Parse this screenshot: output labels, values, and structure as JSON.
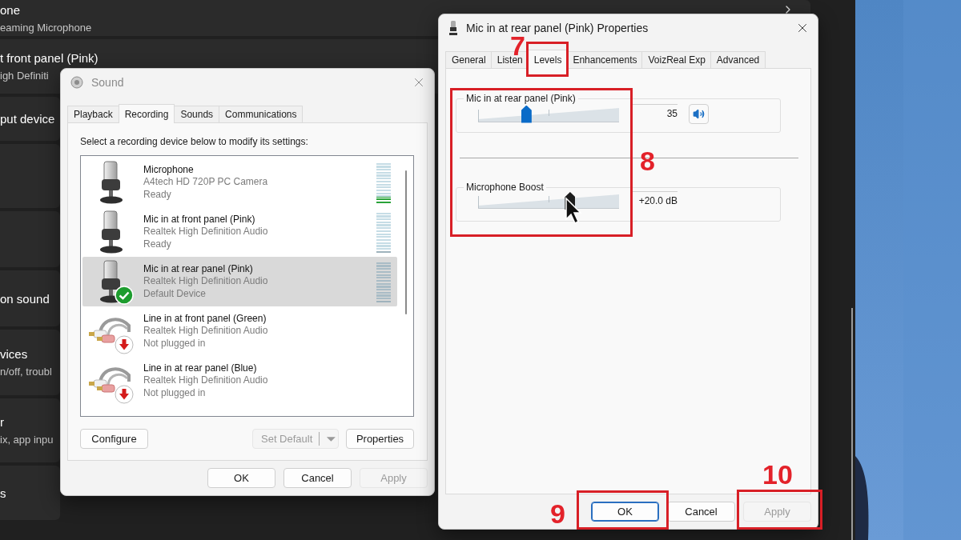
{
  "settings_app": {
    "rows": [
      {
        "title": "one",
        "subtitle": "eaming Microphone"
      },
      {
        "title": "t front panel (Pink)",
        "subtitle": "igh Definiti"
      },
      {
        "title": "put device"
      },
      {
        "title": "on sound"
      },
      {
        "title": "vices",
        "subtitle": "n/off, troubl"
      },
      {
        "title": "r",
        "subtitle": "ix, app inpu"
      },
      {
        "title": "s"
      }
    ]
  },
  "sound_window": {
    "title": "Sound",
    "active": false,
    "tabs": [
      {
        "label": "Playback",
        "selected": false
      },
      {
        "label": "Recording",
        "selected": true
      },
      {
        "label": "Sounds",
        "selected": false
      },
      {
        "label": "Communications",
        "selected": false
      }
    ],
    "instruction": "Select a recording device below to modify its settings:",
    "devices": [
      {
        "name": "Microphone",
        "driver": "A4tech HD 720P PC Camera",
        "status": "Ready",
        "kind": "mic",
        "default_device": false,
        "unplugged": false,
        "level": 0.15,
        "selected": false
      },
      {
        "name": "Mic in at front panel (Pink)",
        "driver": "Realtek High Definition Audio",
        "status": "Ready",
        "kind": "mic",
        "default_device": false,
        "unplugged": false,
        "level": 0,
        "selected": false
      },
      {
        "name": "Mic in at rear panel (Pink)",
        "driver": "Realtek High Definition Audio",
        "status": "Default Device",
        "kind": "mic",
        "default_device": true,
        "unplugged": false,
        "level": 0,
        "selected": true
      },
      {
        "name": "Line in at front panel (Green)",
        "driver": "Realtek High Definition Audio",
        "status": "Not plugged in",
        "kind": "line",
        "default_device": false,
        "unplugged": true,
        "selected": false
      },
      {
        "name": "Line in at rear panel (Blue)",
        "driver": "Realtek High Definition Audio",
        "status": "Not plugged in",
        "kind": "line",
        "default_device": false,
        "unplugged": true,
        "selected": false
      }
    ],
    "buttons": [
      {
        "label": "Configure",
        "kind": "plain",
        "disabled": false
      },
      {
        "label": "Set Default",
        "kind": "split",
        "disabled": true
      },
      {
        "label": "Properties",
        "kind": "plain",
        "disabled": false
      }
    ],
    "footer_buttons": [
      {
        "label": "OK",
        "disabled": false,
        "focused": false
      },
      {
        "label": "Cancel",
        "disabled": false,
        "focused": false
      },
      {
        "label": "Apply",
        "disabled": true,
        "focused": false
      }
    ]
  },
  "properties_window": {
    "title": "Mic in at rear panel (Pink) Properties",
    "active": true,
    "tabs": [
      {
        "label": "General",
        "selected": false
      },
      {
        "label": "Listen",
        "selected": false
      },
      {
        "label": "Levels",
        "selected": true
      },
      {
        "label": "Enhancements",
        "selected": false
      },
      {
        "label": "VoizReal Exp",
        "selected": false
      },
      {
        "label": "Advanced",
        "selected": false
      }
    ],
    "levels": [
      {
        "label": "Mic in at rear panel (Pink)",
        "kind": "volume",
        "level": 0.34,
        "reading": "35",
        "dragging": false
      },
      {
        "label": "Microphone Boost",
        "kind": "boost",
        "level": 0.65,
        "reading": "+20.0 dB",
        "dragging": true
      }
    ],
    "footer_buttons": [
      {
        "label": "OK",
        "disabled": false,
        "focused": true
      },
      {
        "label": "Cancel",
        "disabled": false,
        "focused": false
      },
      {
        "label": "Apply",
        "disabled": true,
        "focused": false
      }
    ]
  },
  "annotations": [
    {
      "label": "7"
    },
    {
      "label": "8"
    },
    {
      "label": "9"
    },
    {
      "label": "10"
    }
  ]
}
